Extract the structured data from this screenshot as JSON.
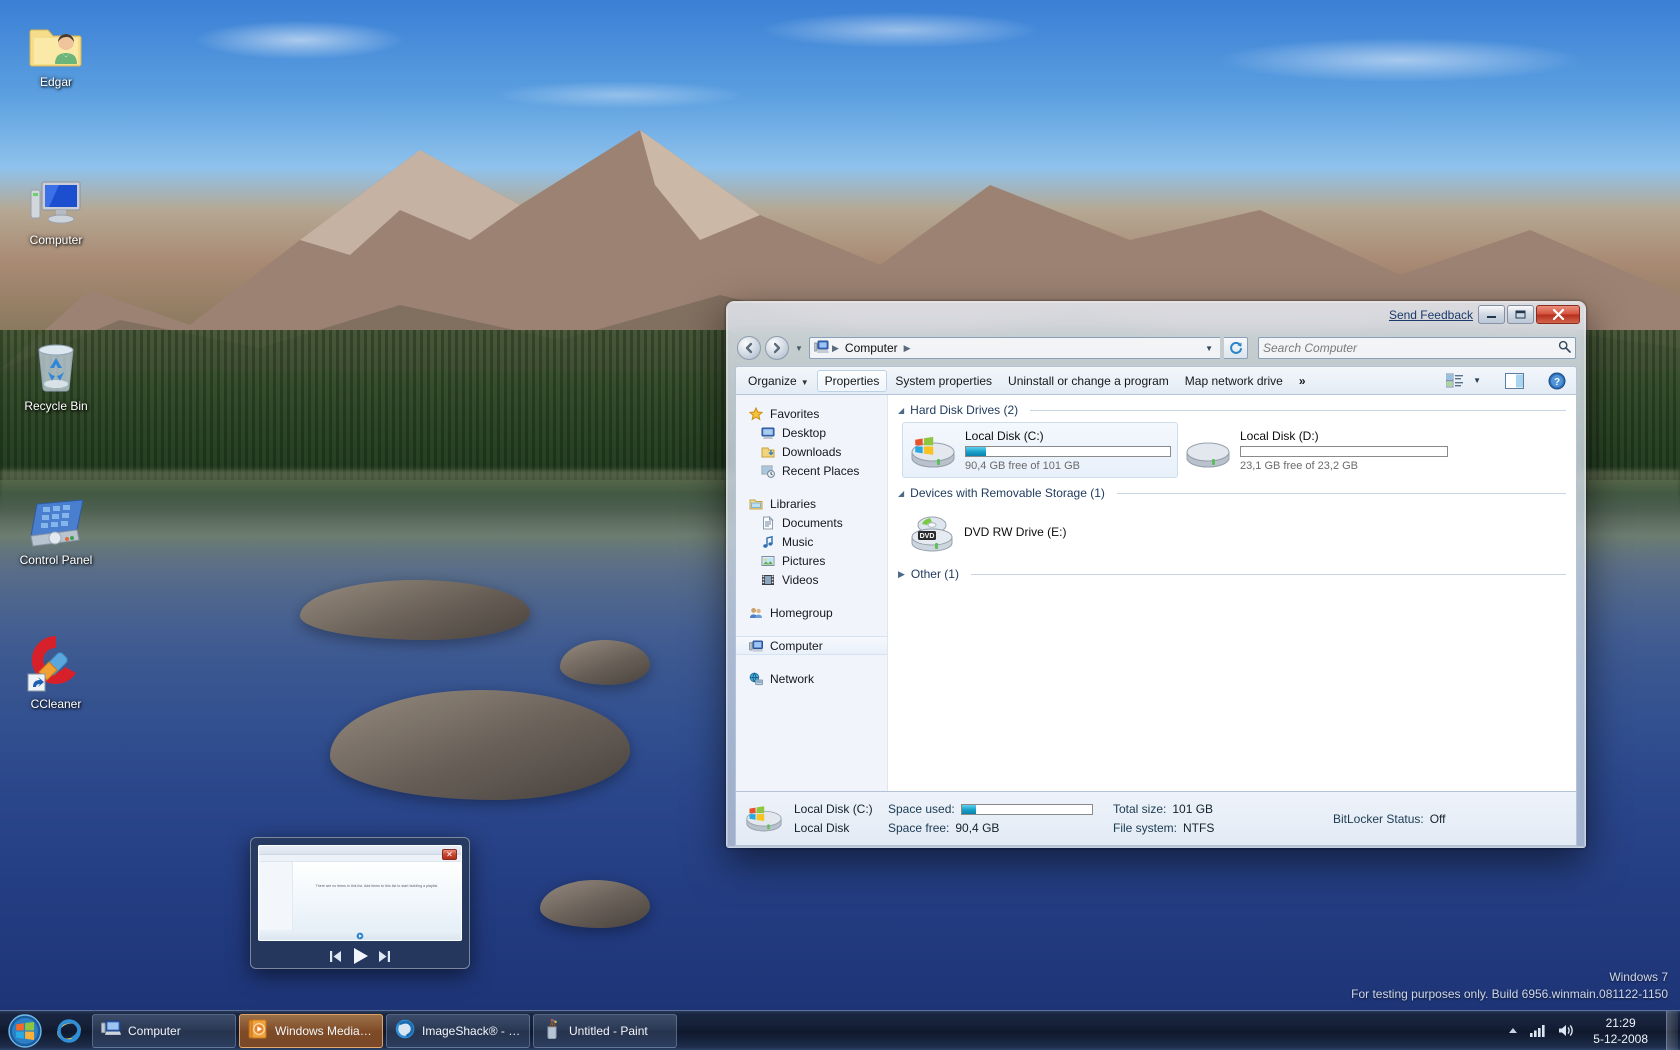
{
  "desktop": {
    "icons": [
      {
        "name": "Edgar",
        "icon": "user-folder-icon"
      },
      {
        "name": "Computer",
        "icon": "computer-icon"
      },
      {
        "name": "Recycle Bin",
        "icon": "recycle-bin-icon"
      },
      {
        "name": "Control Panel",
        "icon": "control-panel-icon"
      },
      {
        "name": "CCleaner",
        "icon": "ccleaner-shortcut-icon"
      }
    ],
    "watermark": {
      "line1": "Windows 7",
      "line2": "For testing purposes only. Build 6956.winmain.081122-1150"
    }
  },
  "window": {
    "send_feedback": "Send Feedback",
    "controls": {
      "minimize": "Minimize",
      "maximize": "Maximize",
      "close": "Close"
    },
    "address": {
      "crumbs": [
        "Computer"
      ],
      "root_icon": "computer-icon",
      "dropdown": "History dropdown",
      "refresh": "Refresh"
    },
    "search": {
      "placeholder": "Search Computer",
      "value": ""
    },
    "toolbar": {
      "organize": "Organize",
      "properties": "Properties",
      "system_properties": "System properties",
      "uninstall": "Uninstall or change a program",
      "map_network_drive": "Map network drive",
      "overflow": "»",
      "views": "Change your view",
      "preview_pane": "Show the preview pane",
      "help": "Help"
    },
    "nav_pane": [
      {
        "label": "Favorites",
        "icon": "star-icon",
        "level": 0,
        "selected": false
      },
      {
        "label": "Desktop",
        "icon": "desktop-icon",
        "level": 1,
        "selected": false
      },
      {
        "label": "Downloads",
        "icon": "downloads-icon",
        "level": 1,
        "selected": false
      },
      {
        "label": "Recent Places",
        "icon": "recent-places-icon",
        "level": 1,
        "selected": false
      },
      {
        "label": "Libraries",
        "icon": "libraries-icon",
        "level": 0,
        "selected": false,
        "gap_before": true
      },
      {
        "label": "Documents",
        "icon": "documents-icon",
        "level": 1,
        "selected": false
      },
      {
        "label": "Music",
        "icon": "music-icon",
        "level": 1,
        "selected": false
      },
      {
        "label": "Pictures",
        "icon": "pictures-icon",
        "level": 1,
        "selected": false
      },
      {
        "label": "Videos",
        "icon": "videos-icon",
        "level": 1,
        "selected": false
      },
      {
        "label": "Homegroup",
        "icon": "homegroup-icon",
        "level": 0,
        "selected": false,
        "gap_before": true
      },
      {
        "label": "Computer",
        "icon": "computer-icon",
        "level": 0,
        "selected": true,
        "gap_before": true
      },
      {
        "label": "Network",
        "icon": "network-icon",
        "level": 0,
        "selected": false,
        "gap_before": true
      }
    ],
    "groups": [
      {
        "title": "Hard Disk Drives (2)",
        "expanded": true,
        "items": [
          {
            "name": "Local Disk (C:)",
            "free_text": "90,4 GB free of 101 GB",
            "used_pct": 10,
            "icon": "windows-drive-icon",
            "selected": true
          },
          {
            "name": "Local Disk (D:)",
            "free_text": "23,1 GB free of 23,2 GB",
            "used_pct": 0,
            "icon": "hard-drive-icon",
            "selected": false
          }
        ]
      },
      {
        "title": "Devices with Removable Storage (1)",
        "expanded": true,
        "items": [
          {
            "name": "DVD RW Drive (E:)",
            "free_text": "",
            "used_pct": -1,
            "icon": "dvd-drive-icon",
            "selected": false
          }
        ]
      },
      {
        "title": "Other (1)",
        "expanded": false,
        "items": []
      }
    ],
    "details": {
      "icon": "windows-drive-icon",
      "name": "Local Disk (C:)",
      "type": "Local Disk",
      "space_used_label": "Space used:",
      "space_used_pct": 10,
      "space_free_label": "Space free:",
      "space_free_value": "90,4 GB",
      "total_size_label": "Total size:",
      "total_size_value": "101 GB",
      "file_system_label": "File system:",
      "file_system_value": "NTFS",
      "bitlocker_label": "BitLocker Status:",
      "bitlocker_value": "Off"
    }
  },
  "thumbnail_preview": {
    "close": "Close",
    "inner_message": "There are no items in this list. Add items to this list to start building a playlist.",
    "controls": {
      "previous": "Previous",
      "play": "Play",
      "next": "Next"
    }
  },
  "taskbar": {
    "start": "Start",
    "quick_launch": [
      {
        "label": "Internet Explorer",
        "icon": "internet-explorer-icon"
      }
    ],
    "tasks": [
      {
        "label": "Computer",
        "icon": "computer-icon",
        "active": false
      },
      {
        "label": "Windows Media P...",
        "icon": "windows-media-player-icon",
        "active": true
      },
      {
        "label": "ImageShack® - I...",
        "icon": "internet-explorer-icon",
        "active": false
      },
      {
        "label": "Untitled - Paint",
        "icon": "paint-icon",
        "active": false
      }
    ],
    "tray": [
      {
        "name": "show-hidden-icons",
        "glyph": "▲"
      },
      {
        "name": "network-icon",
        "glyph": "network"
      },
      {
        "name": "volume-icon",
        "glyph": "volume"
      }
    ],
    "clock": {
      "time": "21:29",
      "date": "5-12-2008"
    },
    "show_desktop": "Show desktop"
  },
  "colors": {
    "accent": "#169ec6",
    "close_red": "#b32f1c",
    "taskbar_active": "#c46c24",
    "link": "#1a3a6b"
  }
}
